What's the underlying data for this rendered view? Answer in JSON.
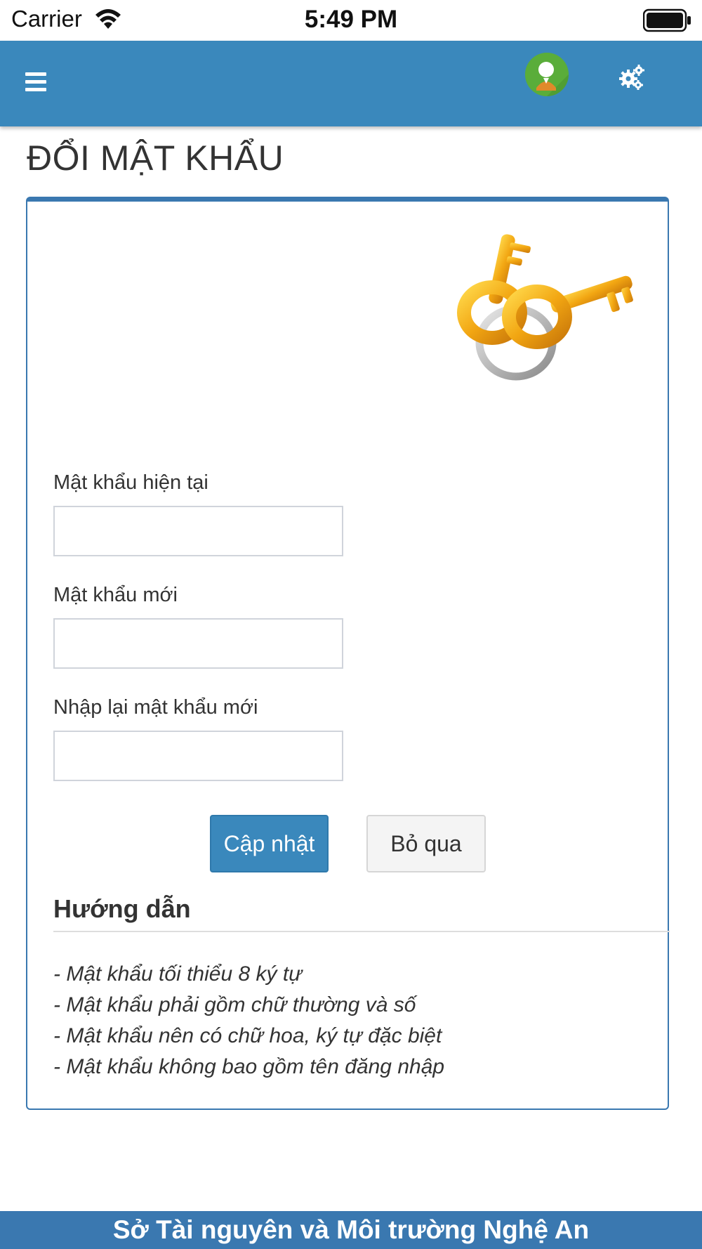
{
  "status_bar": {
    "carrier": "Carrier",
    "time": "5:49 PM"
  },
  "header": {
    "menu_icon": "menu-icon",
    "avatar_icon": "avatar",
    "settings_icon": "gear-icon",
    "background_color": "#3a88bc"
  },
  "page": {
    "title": "ĐỔI MẬT KHẨU"
  },
  "form": {
    "current_password_label": "Mật khẩu hiện tại",
    "current_password_value": "",
    "new_password_label": "Mật khẩu mới",
    "new_password_value": "",
    "confirm_password_label": "Nhập lại mật khẩu mới",
    "confirm_password_value": "",
    "submit_label": "Cập nhật",
    "cancel_label": "Bỏ qua"
  },
  "guide": {
    "title": "Hướng dẫn",
    "items": [
      "- Mật khẩu tối thiểu 8 ký tự",
      "- Mật khẩu phải gồm chữ thường và số",
      "- Mật khẩu nên có chữ hoa, ký tự đặc biệt",
      "- Mật khẩu không bao gồm tên đăng nhập"
    ]
  },
  "footer": {
    "text": "Sở Tài nguyên và Môi trường Nghệ An"
  },
  "colors": {
    "primary": "#3a88bc",
    "card_border": "#3a78b0",
    "text": "#333333"
  }
}
